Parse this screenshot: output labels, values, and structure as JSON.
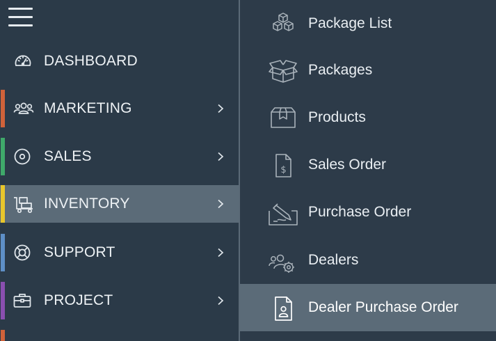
{
  "sidebar": {
    "items": [
      {
        "label": "DASHBOARD",
        "icon": "speedometer-icon",
        "accent": ""
      },
      {
        "label": "MARKETING",
        "icon": "users-icon",
        "accent": "#d0623a"
      },
      {
        "label": "SALES",
        "icon": "target-icon",
        "accent": "#3fa96a"
      },
      {
        "label": "INVENTORY",
        "icon": "dolly-icon",
        "accent": "#e8c62c"
      },
      {
        "label": "SUPPORT",
        "icon": "lifebuoy-icon",
        "accent": "#5e8fc6"
      },
      {
        "label": "PROJECT",
        "icon": "briefcase-icon",
        "accent": "#8a4fb0"
      }
    ],
    "active_item": "INVENTORY"
  },
  "submenu": {
    "items": [
      {
        "label": "Package List",
        "icon": "boxes-icon"
      },
      {
        "label": "Packages",
        "icon": "open-box-icon"
      },
      {
        "label": "Products",
        "icon": "box-icon"
      },
      {
        "label": "Sales Order",
        "icon": "invoice-icon"
      },
      {
        "label": "Purchase Order",
        "icon": "signature-icon"
      },
      {
        "label": "Dealers",
        "icon": "users-gear-icon"
      },
      {
        "label": "Dealer Purchase Order",
        "icon": "user-document-icon"
      }
    ],
    "active_item": "Dealer Purchase Order"
  },
  "colors": {
    "background": "#2b3a48",
    "active_bg": "#5b6b78",
    "text": "#eef2f5"
  }
}
